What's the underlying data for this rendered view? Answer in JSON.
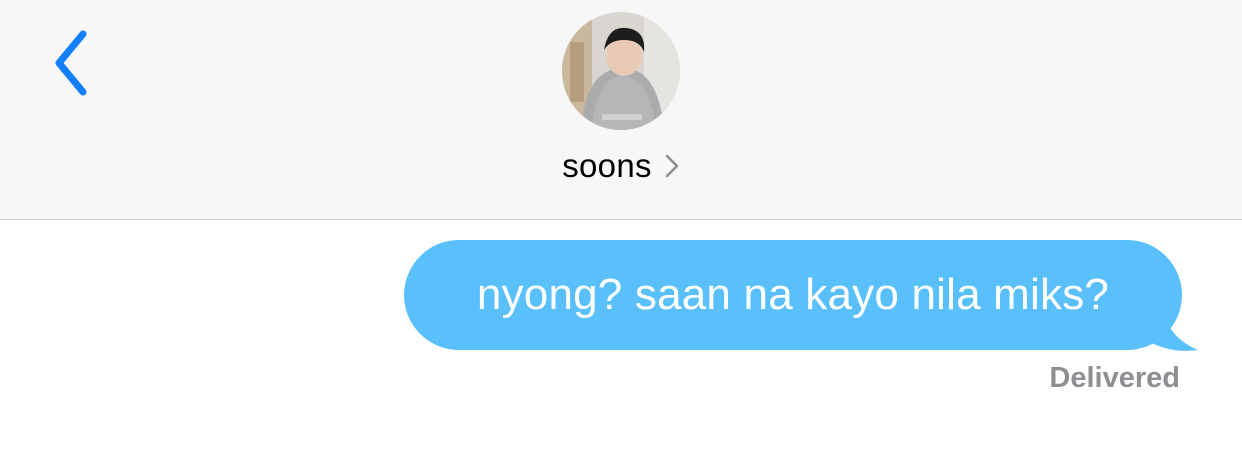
{
  "header": {
    "back_icon": "chevron-left-icon",
    "contact": {
      "name": "soons",
      "chevron_icon": "chevron-right-icon",
      "avatar_icon": "contact-photo"
    }
  },
  "messages": [
    {
      "direction": "outgoing",
      "text": "nyong? saan na kayo nila miks?",
      "status": "Delivered"
    }
  ],
  "colors": {
    "accent": "#147efb",
    "bubble": "#5ac0fb",
    "header_bg": "#f7f7f7",
    "status_text": "#8e8e93"
  }
}
